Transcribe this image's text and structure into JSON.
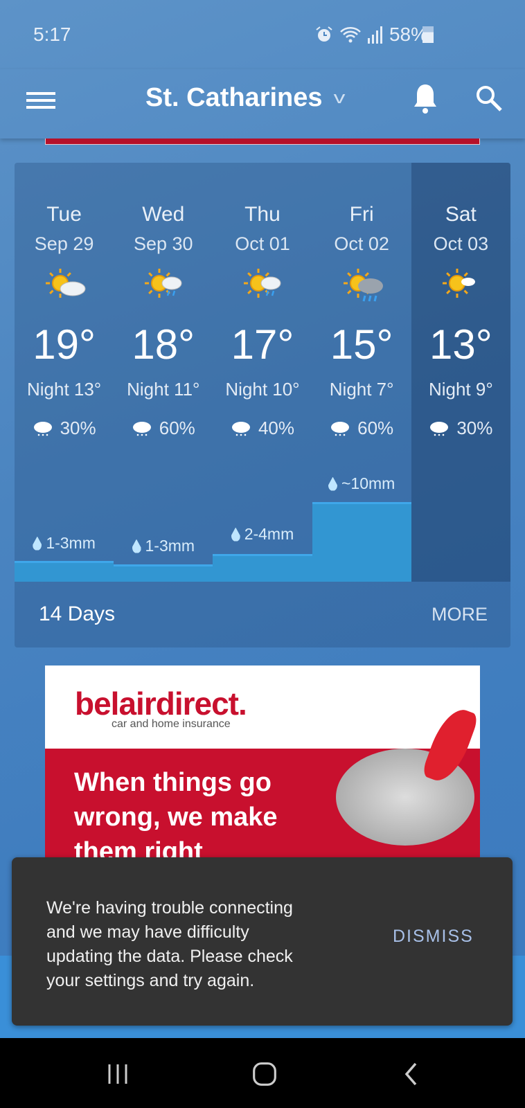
{
  "status_bar": {
    "time": "5:17",
    "battery": "58%",
    "icons": [
      "alarm-icon",
      "wifi-icon",
      "signal-icon",
      "battery-icon"
    ]
  },
  "header": {
    "location": "St. Catharines",
    "icons": [
      "menu-icon",
      "chevron-down-icon",
      "bell-icon",
      "search-icon"
    ]
  },
  "forecast": {
    "days": [
      {
        "day": "Tue",
        "date": "Sep 29",
        "icon": "partly-cloudy-icon",
        "high": "19°",
        "night": "Night 13°",
        "pop": "30%",
        "precip": "1-3mm"
      },
      {
        "day": "Wed",
        "date": "Sep 30",
        "icon": "sun-cloud-rain-icon",
        "high": "18°",
        "night": "Night 11°",
        "pop": "60%",
        "precip": "1-3mm"
      },
      {
        "day": "Thu",
        "date": "Oct 01",
        "icon": "sun-cloud-rain-icon",
        "high": "17°",
        "night": "Night 10°",
        "pop": "40%",
        "precip": "2-4mm"
      },
      {
        "day": "Fri",
        "date": "Oct 02",
        "icon": "sun-cloud-heavy-rain-icon",
        "high": "15°",
        "night": "Night 7°",
        "pop": "60%",
        "precip": "~10mm"
      },
      {
        "day": "Sat",
        "date": "Oct 03",
        "icon": "sun-small-cloud-icon",
        "high": "13°",
        "night": "Night 9°",
        "pop": "30%",
        "precip": ""
      }
    ],
    "selected": "Sat",
    "precip_color": "#3296d2",
    "footer_label": "14 Days",
    "more_label": "MORE"
  },
  "ad": {
    "brand": "belairdirect.",
    "tagline": "car and home insurance",
    "headline": "When things go\nwrong, we make\nthem right",
    "brand_color": "#c8102e"
  },
  "snackbar": {
    "message": "We're having trouble connecting\nand we may have difficulty\nupdating the data. Please check\nyour settings and try again.",
    "action": "DISMISS"
  },
  "nav_bar": {
    "icons": [
      "recent-apps-icon",
      "home-icon",
      "back-icon"
    ]
  }
}
